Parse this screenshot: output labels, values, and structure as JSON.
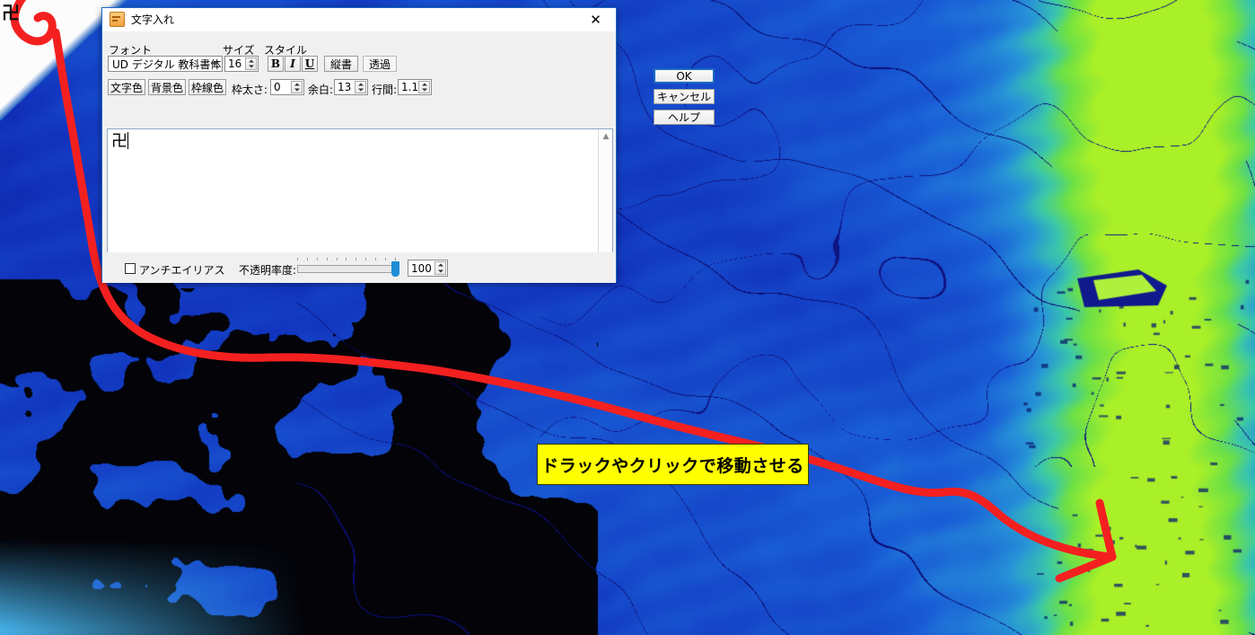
{
  "window": {
    "title": "文字入れ",
    "icon": "app-icon",
    "close_label": "✕"
  },
  "font_group": {
    "caption": "フォント",
    "family_value": "UD デジタル 教科書体"
  },
  "size_group": {
    "caption": "サイズ",
    "value": "16"
  },
  "style_group": {
    "caption": "スタイル",
    "bold": "B",
    "italic": "I",
    "underline": "U",
    "vertical_label": "縦書",
    "transparent_label": "透過"
  },
  "color_buttons": {
    "text_color": "文字色",
    "background_color": "背景色",
    "border_color": "枠線色"
  },
  "numeric_fields": {
    "border_width_label": "枠太さ:",
    "border_width_value": "0",
    "margin_label": "余白:",
    "margin_value": "13",
    "line_spacing_label": "行間:",
    "line_spacing_value": "1.1"
  },
  "editor": {
    "content": "卍"
  },
  "bottom": {
    "antialias_label": "アンチエイリアス",
    "antialias_checked": false,
    "opacity_label": "不透明率度:",
    "opacity_value": "100"
  },
  "actions": {
    "ok": "OK",
    "cancel": "キャンセル",
    "help": "ヘルプ"
  },
  "map": {
    "manji_marker": "卍",
    "callout_text": "ドラックやクリックで移動させる",
    "callout_bg": "#ffff00",
    "annotation_color": "#f42020"
  }
}
